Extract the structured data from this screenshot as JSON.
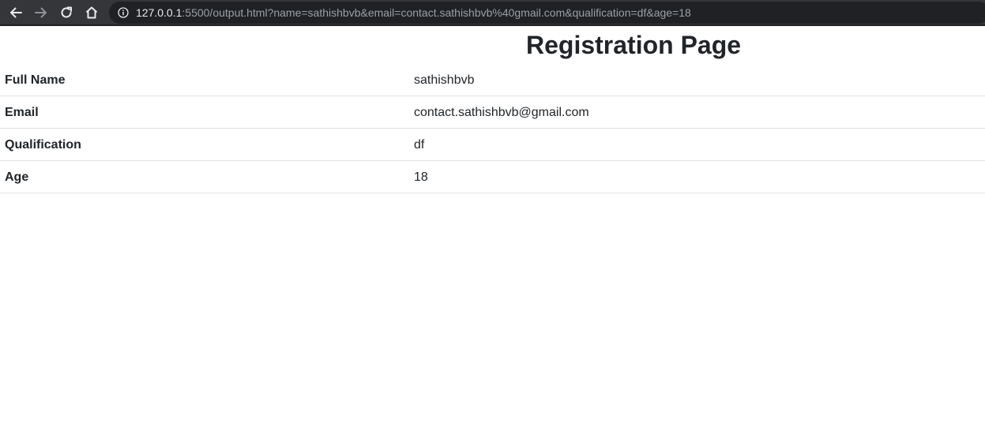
{
  "browser": {
    "url_host": "127.0.0.1",
    "url_rest": ":5500/output.html?name=sathishbvb&email=contact.sathishbvb%40gmail.com&qualification=df&age=18",
    "icons": {
      "back": "arrow-left-icon",
      "forward": "arrow-right-icon",
      "reload": "reload-icon",
      "home": "home-icon",
      "info": "info-icon"
    },
    "colors": {
      "toolbar": "#35363a",
      "omnibox": "#202124"
    }
  },
  "page": {
    "title": "Registration Page",
    "rows": [
      {
        "label": "Full Name",
        "value": "sathishbvb"
      },
      {
        "label": "Email",
        "value": "contact.sathishbvb@gmail.com"
      },
      {
        "label": "Qualification",
        "value": "df"
      },
      {
        "label": "Age",
        "value": "18"
      }
    ]
  }
}
